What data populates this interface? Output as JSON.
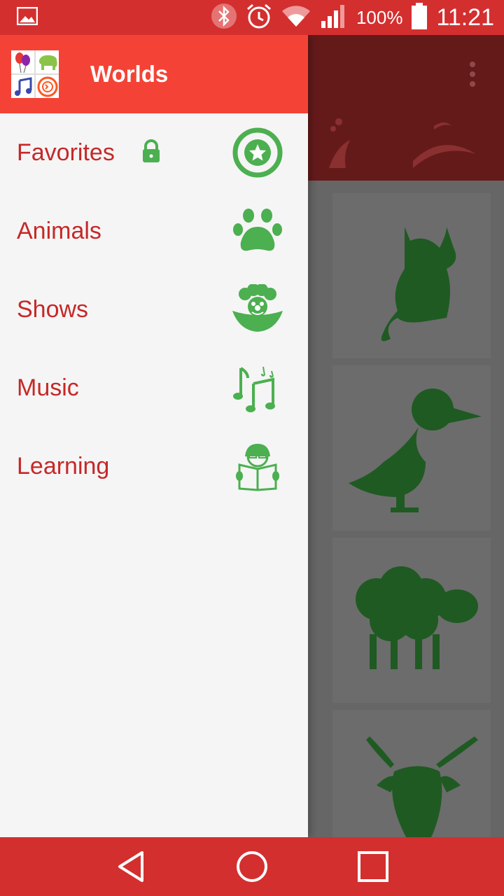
{
  "status_bar": {
    "battery": "100%",
    "time": "11:21",
    "icons": [
      "image-icon",
      "bluetooth-icon",
      "alarm-icon",
      "wifi-icon",
      "signal-icon",
      "battery-icon"
    ]
  },
  "drawer": {
    "title": "Worlds",
    "items": [
      {
        "label": "Favorites",
        "icon": "star-icon",
        "locked": true
      },
      {
        "label": "Animals",
        "icon": "paw-icon",
        "locked": false
      },
      {
        "label": "Shows",
        "icon": "clown-icon",
        "locked": false
      },
      {
        "label": "Music",
        "icon": "music-notes-icon",
        "locked": false
      },
      {
        "label": "Learning",
        "icon": "reading-kid-icon",
        "locked": false
      }
    ]
  },
  "background": {
    "tiles": [
      "cat-icon",
      "duck-icon",
      "sheep-icon",
      "goat-icon"
    ]
  },
  "colors": {
    "primary": "#d32f2f",
    "accent": "#f44336",
    "label": "#c62828",
    "icon_green": "#4caf50",
    "tile_green": "#1b5e20"
  }
}
